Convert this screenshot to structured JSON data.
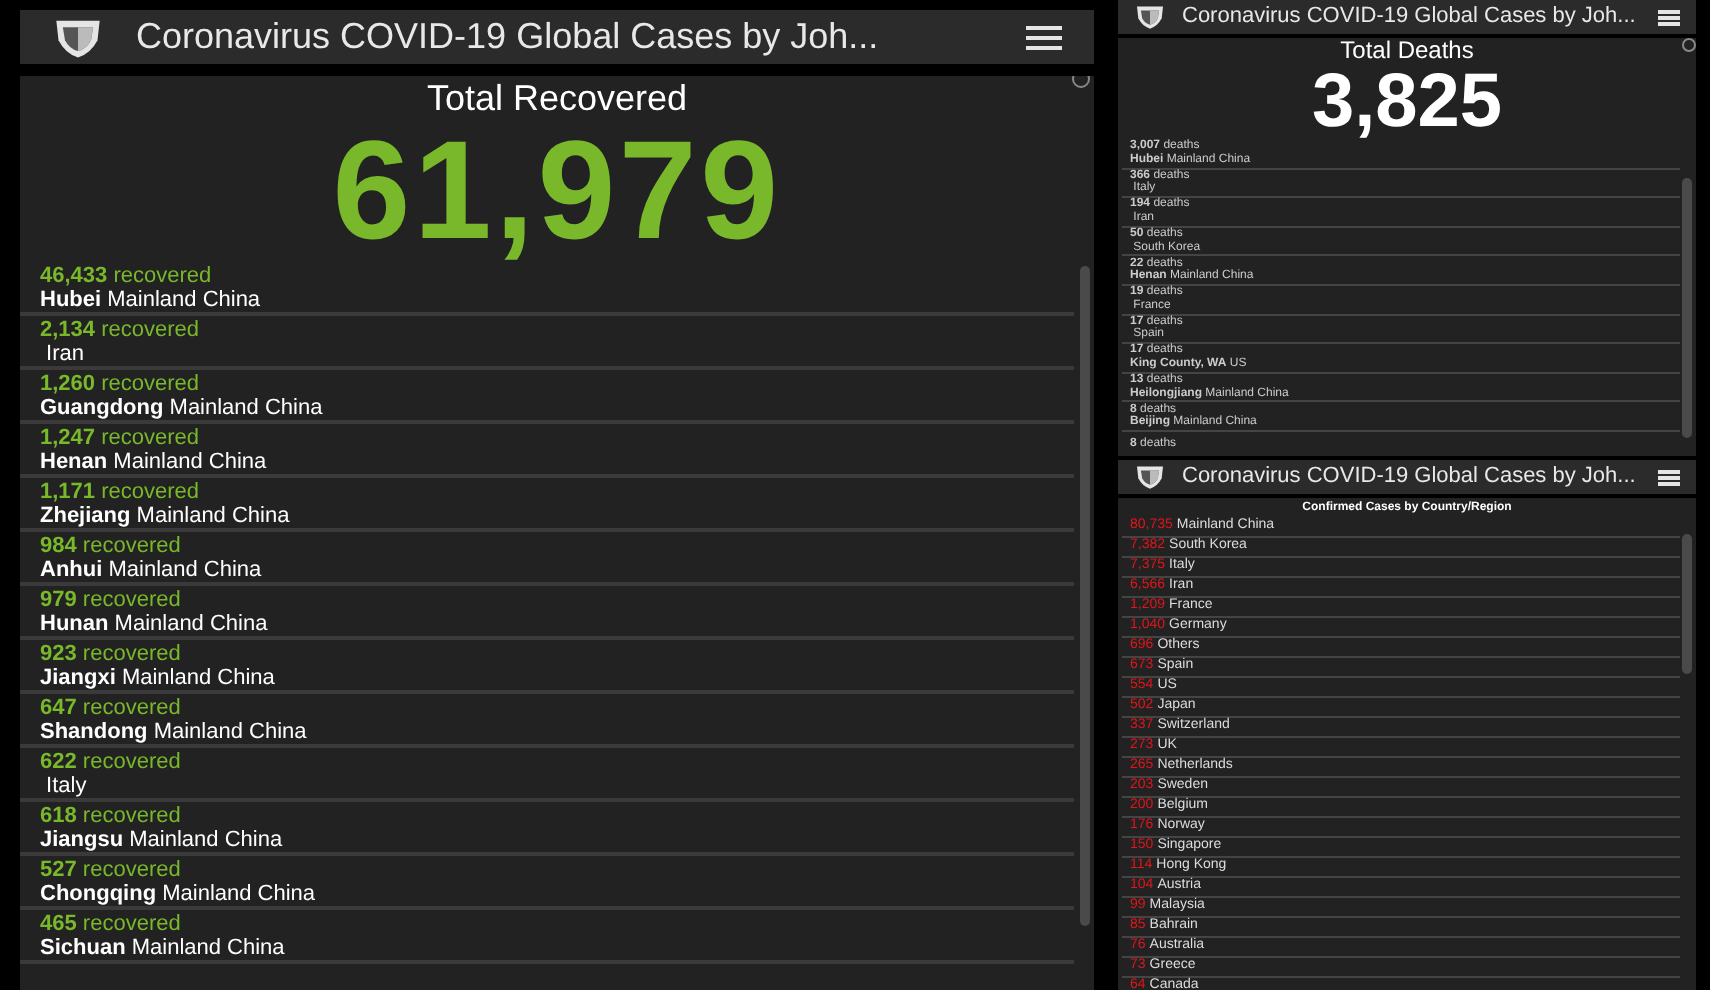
{
  "recovered_panel": {
    "header_title": "Coronavirus COVID-19 Global Cases by Joh...",
    "title": "Total Recovered",
    "total": "61,979",
    "rows": [
      {
        "count": "46,433",
        "unit": "recovered",
        "place": "**Hubei** Mainland China"
      },
      {
        "count": "2,134",
        "unit": "recovered",
        "place": " Iran"
      },
      {
        "count": "1,260",
        "unit": "recovered",
        "place": "**Guangdong** Mainland China"
      },
      {
        "count": "1,247",
        "unit": "recovered",
        "place": "**Henan** Mainland China"
      },
      {
        "count": "1,171",
        "unit": "recovered",
        "place": "**Zhejiang** Mainland China"
      },
      {
        "count": "984",
        "unit": "recovered",
        "place": "**Anhui** Mainland China"
      },
      {
        "count": "979",
        "unit": "recovered",
        "place": "**Hunan** Mainland China"
      },
      {
        "count": "923",
        "unit": "recovered",
        "place": "**Jiangxi** Mainland China"
      },
      {
        "count": "647",
        "unit": "recovered",
        "place": "**Shandong** Mainland China"
      },
      {
        "count": "622",
        "unit": "recovered",
        "place": " Italy"
      },
      {
        "count": "618",
        "unit": "recovered",
        "place": "**Jiangsu** Mainland China"
      },
      {
        "count": "527",
        "unit": "recovered",
        "place": "**Chongqing** Mainland China"
      },
      {
        "count": "465",
        "unit": "recovered",
        "place": "**Sichuan** Mainland China"
      }
    ]
  },
  "deaths_panel": {
    "header_title": "Coronavirus COVID-19 Global Cases by Joh...",
    "title": "Total Deaths",
    "total": "3,825",
    "rows": [
      {
        "count": "3,007",
        "unit": "deaths",
        "place": "**Hubei** Mainland China"
      },
      {
        "count": "366",
        "unit": "deaths",
        "place": " Italy"
      },
      {
        "count": "194",
        "unit": "deaths",
        "place": " Iran"
      },
      {
        "count": "50",
        "unit": "deaths",
        "place": " South Korea"
      },
      {
        "count": "22",
        "unit": "deaths",
        "place": "**Henan** Mainland China"
      },
      {
        "count": "19",
        "unit": "deaths",
        "place": " France"
      },
      {
        "count": "17",
        "unit": "deaths",
        "place": " Spain"
      },
      {
        "count": "17",
        "unit": "deaths",
        "place": "**King County, WA** US"
      },
      {
        "count": "13",
        "unit": "deaths",
        "place": "**Heilongjiang** Mainland China"
      },
      {
        "count": "8",
        "unit": "deaths",
        "place": "**Beijing** Mainland China"
      },
      {
        "count": "8",
        "unit": "deaths"
      }
    ]
  },
  "confirmed_panel": {
    "header_title": "Coronavirus COVID-19 Global Cases by Joh...",
    "title": "Confirmed Cases by Country/Region",
    "rows": [
      {
        "count": "80,735",
        "place": "Mainland China"
      },
      {
        "count": "7,382",
        "place": "South Korea"
      },
      {
        "count": "7,375",
        "place": "Italy"
      },
      {
        "count": "6,566",
        "place": "Iran"
      },
      {
        "count": "1,209",
        "place": "France"
      },
      {
        "count": "1,040",
        "place": "Germany"
      },
      {
        "count": "696",
        "place": "Others"
      },
      {
        "count": "673",
        "place": "Spain"
      },
      {
        "count": "554",
        "place": "US"
      },
      {
        "count": "502",
        "place": "Japan"
      },
      {
        "count": "337",
        "place": "Switzerland"
      },
      {
        "count": "273",
        "place": "UK"
      },
      {
        "count": "265",
        "place": "Netherlands"
      },
      {
        "count": "203",
        "place": "Sweden"
      },
      {
        "count": "200",
        "place": "Belgium"
      },
      {
        "count": "176",
        "place": "Norway"
      },
      {
        "count": "150",
        "place": "Singapore"
      },
      {
        "count": "114",
        "place": "Hong Kong"
      },
      {
        "count": "104",
        "place": "Austria"
      },
      {
        "count": "99",
        "place": "Malaysia"
      },
      {
        "count": "85",
        "place": "Bahrain"
      },
      {
        "count": "76",
        "place": "Australia"
      },
      {
        "count": "73",
        "place": "Greece"
      },
      {
        "count": "64",
        "place": "Canada"
      }
    ]
  }
}
